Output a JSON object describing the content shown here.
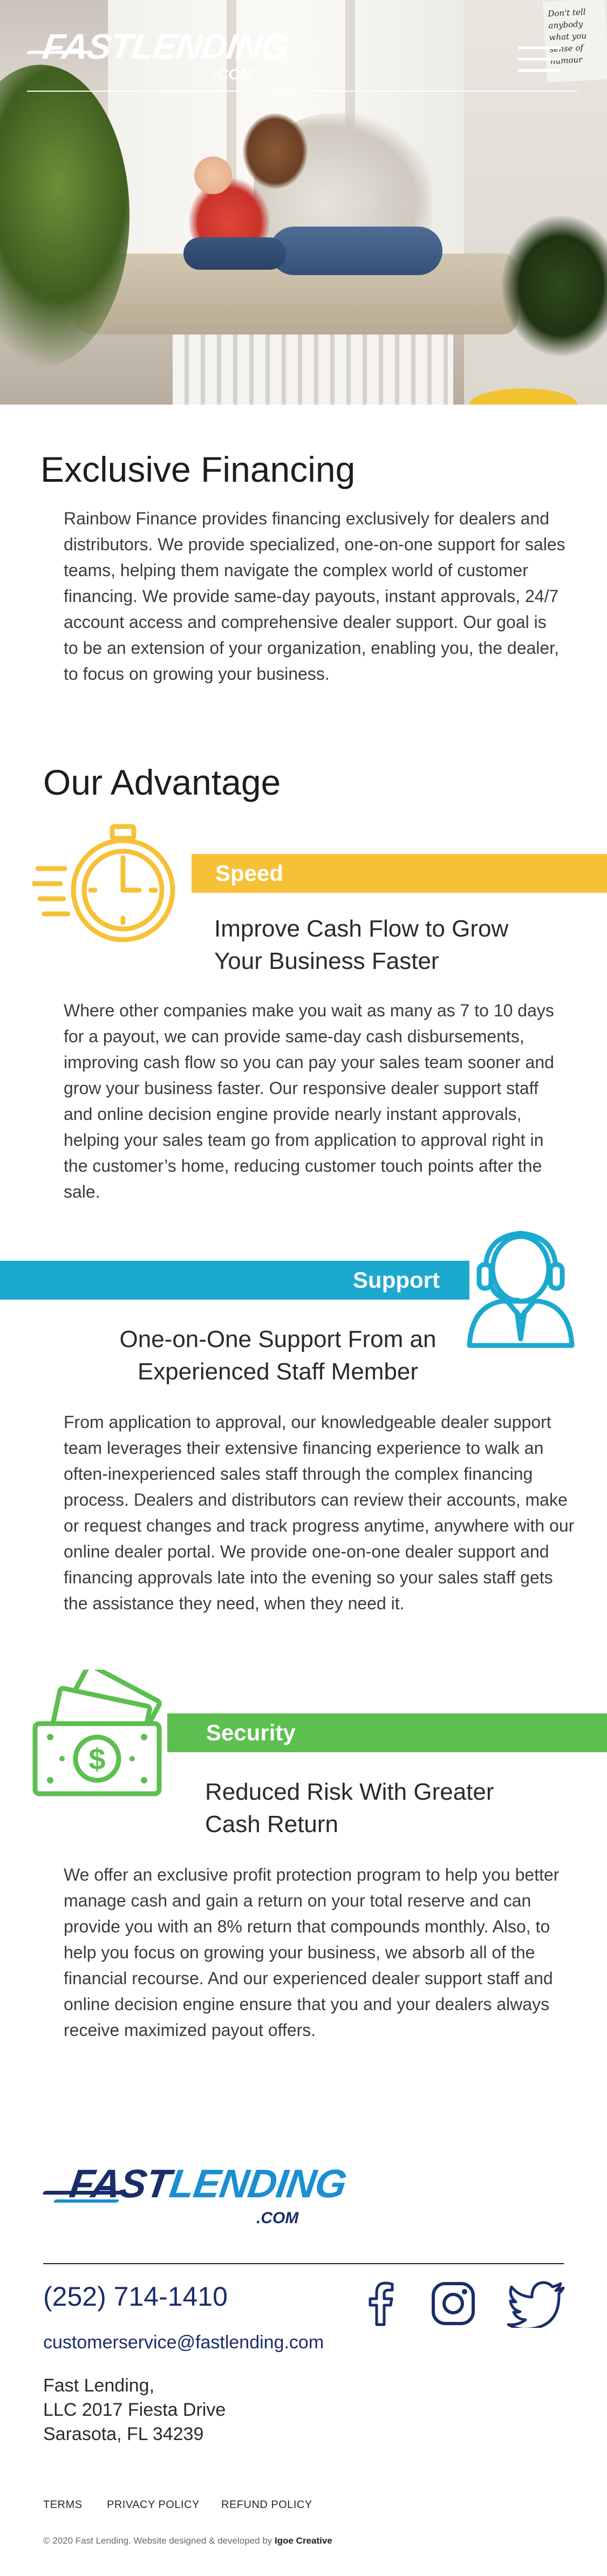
{
  "header": {
    "logo_word": "FASTLENDING",
    "logo_com": ".COM",
    "menu_icon": "hamburger-icon",
    "hero_note": "Don't tell anybody what you sense of humour"
  },
  "intro": {
    "title": "Exclusive Financing",
    "body": "Rainbow Finance provides financing exclusively for dealers and distributors. We provide specialized, one-on-one support for sales teams, helping them navigate the complex world of customer financing. We provide same-day payouts, instant approvals, 24/7 account access and comprehensive dealer support. Our goal is to be an extension of your organization, enabling you, the dealer, to focus on growing your business."
  },
  "advantage": {
    "title": "Our Advantage",
    "items": [
      {
        "label": "Speed",
        "icon": "stopwatch-icon",
        "color": "#f7c137",
        "heading": "Improve Cash Flow to Grow Your Business Faster",
        "body": "Where other companies make you wait as many as 7 to 10 days for a payout, we can provide same-day  cash disbursements, improving cash flow so you can pay your sales team sooner and grow your business faster. Our responsive dealer support staff and online decision engine provide nearly instant approvals, helping your sales team go from application to approval right in the customer’s home, reducing customer touch points after the sale."
      },
      {
        "label": "Support",
        "icon": "headset-agent-icon",
        "color": "#1ba9cf",
        "heading": "One-on-One Support From an Experienced Staff Member",
        "body": "From application to approval, our knowledgeable dealer support team leverages their extensive financing experience to walk an often-inexperienced sales staff through the complex financing process. Dealers and distributors can review their accounts, make or request changes and track progress anytime, anywhere with our online dealer portal. We provide one-on-one dealer support and financing approvals late into the evening so your sales staff gets the assistance they need, when they need it."
      },
      {
        "label": "Security",
        "icon": "cash-bills-icon",
        "color": "#5cbf4f",
        "heading": "Reduced Risk With Greater Cash Return",
        "body": "We offer an exclusive profit protection program to help you better manage cash and gain a return on your total reserve and can provide you with an 8% return that compounds monthly. Also, to help you focus on growing your business, we absorb all of the financial recourse. And our experienced dealer support staff and online decision engine ensure that you and your dealers always receive maximized payout offers."
      }
    ]
  },
  "footer": {
    "logo_fast": "FAST",
    "logo_lending": "LENDING",
    "logo_com": ".COM",
    "phone": "(252) 714-1410",
    "email": "customerservice@fastlending.com",
    "address_lines": [
      "Fast Lending,",
      "LLC 2017 Fiesta Drive",
      "Sarasota, FL 34239"
    ],
    "social": [
      "facebook-icon",
      "instagram-icon",
      "twitter-icon"
    ],
    "links": [
      "TERMS",
      "PRIVACY POLICY",
      "REFUND POLICY"
    ],
    "copyright": "© 2020 Fast Lending. Website designed & developed by",
    "credit": "Igoe Creative"
  }
}
